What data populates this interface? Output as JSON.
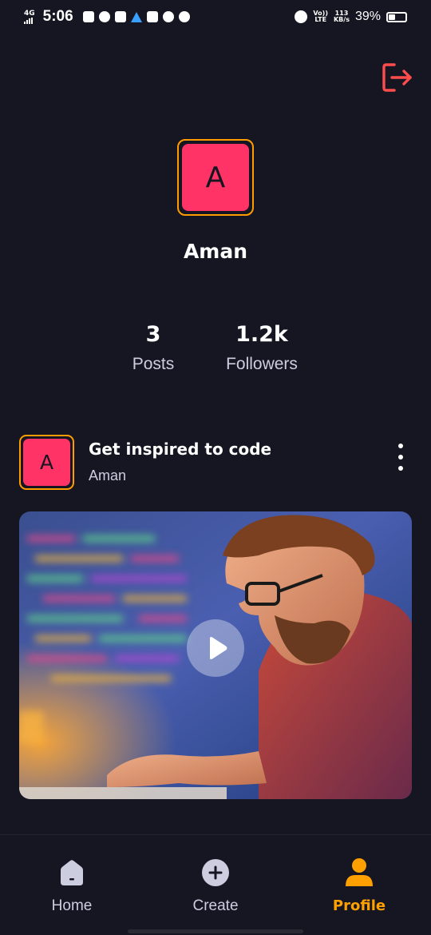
{
  "status_bar": {
    "network": "4G",
    "time": "5:06",
    "volte": "Vo))",
    "lte": "LTE",
    "speed_value": "113",
    "speed_unit": "KB/s",
    "battery_percent": "39%",
    "battery_level": 0.39
  },
  "profile": {
    "avatar_letter": "A",
    "username": "Aman",
    "stats": {
      "posts_value": "3",
      "posts_label": "Posts",
      "followers_value": "1.2k",
      "followers_label": "Followers"
    }
  },
  "post": {
    "avatar_letter": "A",
    "title": "Get inspired to code",
    "author": "Aman"
  },
  "nav": {
    "home": "Home",
    "create": "Create",
    "profile": "Profile"
  },
  "colors": {
    "background": "#161622",
    "accent_orange": "#ff9c01",
    "avatar_pink": "#ff3366",
    "logout_red": "#ff4d4d",
    "active_tab": "#ffa001"
  },
  "icons": {
    "logout": "logout-icon",
    "menu": "vertical-dots-icon",
    "play": "play-icon",
    "home": "home-icon",
    "create": "plus-icon",
    "profile": "user-icon"
  }
}
